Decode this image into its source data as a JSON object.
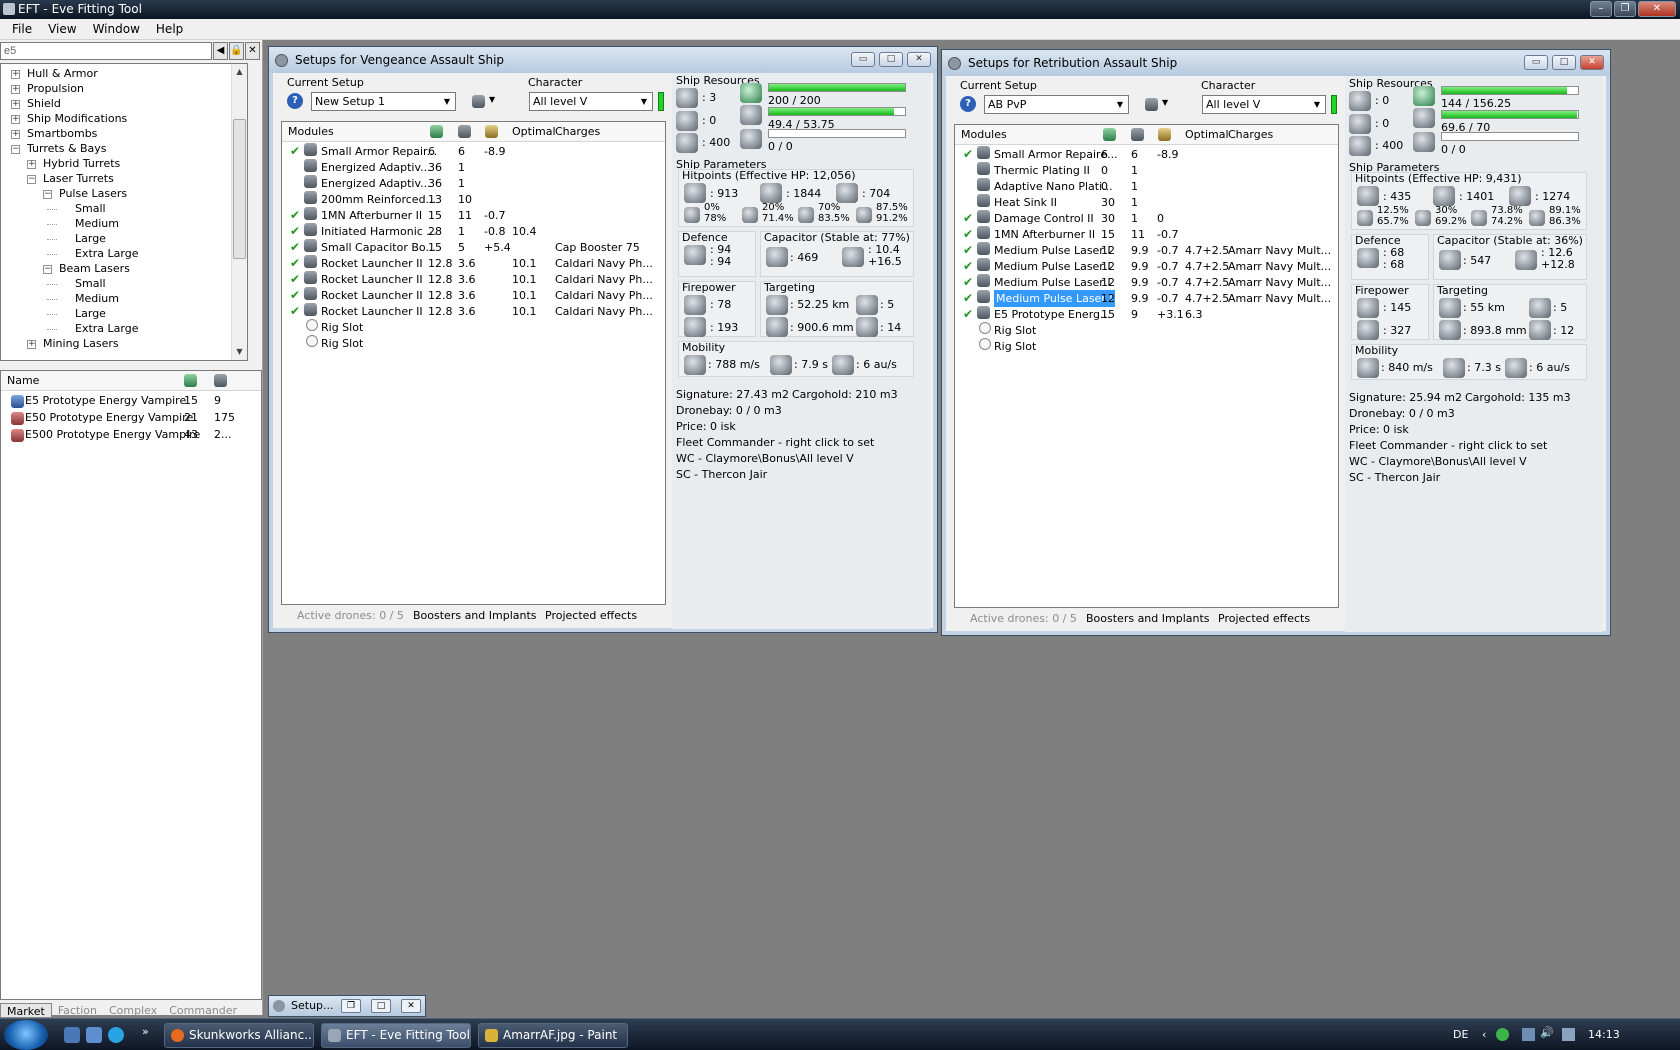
{
  "app": {
    "title": "EFT - Eve Fitting Tool",
    "menu": [
      "File",
      "View",
      "Window",
      "Help"
    ]
  },
  "left": {
    "search_value": "e5",
    "tree": [
      {
        "label": "Hull & Armor",
        "sign": "+"
      },
      {
        "label": "Propulsion",
        "sign": "+"
      },
      {
        "label": "Shield",
        "sign": "+"
      },
      {
        "label": "Ship Modifications",
        "sign": "+"
      },
      {
        "label": "Smartbombs",
        "sign": "+"
      },
      {
        "label": "Turrets & Bays",
        "sign": "−"
      },
      {
        "label": "Hybrid Turrets",
        "sign": "+"
      },
      {
        "label": "Laser Turrets",
        "sign": "−"
      },
      {
        "label": "Pulse Lasers",
        "sign": "−"
      },
      {
        "label": "Small",
        "sign": ""
      },
      {
        "label": "Medium",
        "sign": ""
      },
      {
        "label": "Large",
        "sign": ""
      },
      {
        "label": "Extra Large",
        "sign": ""
      },
      {
        "label": "Beam Lasers",
        "sign": "−"
      },
      {
        "label": "Small",
        "sign": ""
      },
      {
        "label": "Medium",
        "sign": ""
      },
      {
        "label": "Large",
        "sign": ""
      },
      {
        "label": "Extra Large",
        "sign": ""
      },
      {
        "label": "Mining Lasers",
        "sign": "+"
      }
    ],
    "list_header": "Name",
    "items": [
      {
        "name": "E5 Prototype Energy Vampire",
        "c1": "15",
        "c2": "9"
      },
      {
        "name": "E50 Prototype Energy Vampire",
        "c1": "21",
        "c2": "175"
      },
      {
        "name": "E500 Prototype Energy Vampire",
        "c1": "43",
        "c2": "2..."
      }
    ],
    "bottom_tabs": [
      "Market",
      "Faction",
      "Complex",
      "Commander"
    ]
  },
  "win1": {
    "title": "Setups for Vengeance Assault Ship",
    "current_setup_label": "Current Setup",
    "setup": "New Setup 1",
    "character_label": "Character",
    "character": "All level V",
    "cols": {
      "modules": "Modules",
      "optimal": "Optimal",
      "charges": "Charges"
    },
    "modules": [
      {
        "check": "✔",
        "name": "Small Armor Repair...",
        "a": "6",
        "b": "6",
        "c": "-8.9",
        "opt": "",
        "charge": ""
      },
      {
        "check": "",
        "name": "Energized Adaptiv...",
        "a": "36",
        "b": "1",
        "c": "",
        "opt": "",
        "charge": ""
      },
      {
        "check": "",
        "name": "Energized Adaptiv...",
        "a": "36",
        "b": "1",
        "c": "",
        "opt": "",
        "charge": ""
      },
      {
        "check": "",
        "name": "200mm Reinforced...",
        "a": "13",
        "b": "10",
        "c": "",
        "opt": "",
        "charge": ""
      },
      {
        "check": "✔",
        "name": "1MN Afterburner II",
        "a": "15",
        "b": "11",
        "c": "-0.7",
        "opt": "",
        "charge": ""
      },
      {
        "check": "✔",
        "name": "Initiated Harmonic ...",
        "a": "28",
        "b": "1",
        "c": "-0.8",
        "opt": "10.4",
        "charge": ""
      },
      {
        "check": "✔",
        "name": "Small Capacitor Bo...",
        "a": "15",
        "b": "5",
        "c": "+5.4",
        "opt": "",
        "charge": "Cap Booster 75"
      },
      {
        "check": "✔",
        "name": "Rocket Launcher II",
        "a": "12.8",
        "b": "3.6",
        "c": "",
        "opt": "10.1",
        "charge": "Caldari Navy Ph..."
      },
      {
        "check": "✔",
        "name": "Rocket Launcher II",
        "a": "12.8",
        "b": "3.6",
        "c": "",
        "opt": "10.1",
        "charge": "Caldari Navy Ph..."
      },
      {
        "check": "✔",
        "name": "Rocket Launcher II",
        "a": "12.8",
        "b": "3.6",
        "c": "",
        "opt": "10.1",
        "charge": "Caldari Navy Ph..."
      },
      {
        "check": "✔",
        "name": "Rocket Launcher II",
        "a": "12.8",
        "b": "3.6",
        "c": "",
        "opt": "10.1",
        "charge": "Caldari Navy Ph..."
      }
    ],
    "rigs": [
      "Rig Slot",
      "Rig Slot"
    ],
    "bottom": {
      "drones": "Active drones: 0 / 5",
      "boosters": "Boosters and Implants",
      "projected": "Projected effects"
    },
    "res": {
      "label": "Ship Resources",
      "hi": ": 3",
      "turret": ": 0",
      "cal": ": 400",
      "cpu": "200 / 200",
      "cpu_frac": 1.0,
      "pg": "49.4 / 53.75",
      "pg_frac": 0.92,
      "drone": "0 / 0",
      "drone_frac": 0
    },
    "params_label": "Ship Parameters",
    "hp": {
      "label": "Hitpoints (Effective HP: 12,056)",
      "shield": ": 913",
      "armor": ": 1844",
      "hull": ": 704"
    },
    "resist": [
      [
        "0%",
        "78%"
      ],
      [
        "20%",
        "71.4%"
      ],
      [
        "70%",
        "83.5%"
      ],
      [
        "87.5%",
        "91.2%"
      ]
    ],
    "defence": {
      "label": "Defence",
      "v1": ": 94",
      "v2": ": 94"
    },
    "cap": {
      "label": "Capacitor (Stable at: 77%)",
      "v": ": 469",
      "r1": ": 10.4",
      "r2": "+16.5"
    },
    "fire": {
      "label": "Firepower",
      "v1": ": 78",
      "v2": ": 193"
    },
    "target": {
      "label": "Targeting",
      "range": ": 52.25 km",
      "res": ": 900.6 mm",
      "max": ": 5",
      "sens": ": 14"
    },
    "mob": {
      "label": "Mobility",
      "speed": ": 788 m/s",
      "align": ": 7.9 s",
      "warp": ": 6 au/s"
    },
    "info": [
      "Signature: 27.43 m2",
      "Cargohold: 210 m3",
      "Dronebay: 0 / 0 m3",
      "Price: 0 isk",
      "Fleet Commander - right click to set",
      "WC - Claymore\\Bonus\\All level V",
      "SC - Thercon Jair"
    ]
  },
  "win2": {
    "title": "Setups for Retribution Assault Ship",
    "current_setup_label": "Current Setup",
    "setup": "AB PvP",
    "character_label": "Character",
    "character": "All level V",
    "cols": {
      "modules": "Modules",
      "optimal": "Optimal",
      "charges": "Charges"
    },
    "modules": [
      {
        "check": "✔",
        "name": "Small Armor Repaire...",
        "a": "6",
        "b": "6",
        "c": "-8.9",
        "opt": "",
        "charge": ""
      },
      {
        "check": "",
        "name": "Thermic Plating II",
        "a": "0",
        "b": "1",
        "c": "",
        "opt": "",
        "charge": ""
      },
      {
        "check": "",
        "name": "Adaptive Nano Plati...",
        "a": "0",
        "b": "1",
        "c": "",
        "opt": "",
        "charge": ""
      },
      {
        "check": "",
        "name": "Heat Sink II",
        "a": "30",
        "b": "1",
        "c": "",
        "opt": "",
        "charge": ""
      },
      {
        "check": "✔",
        "name": "Damage Control II",
        "a": "30",
        "b": "1",
        "c": "0",
        "opt": "",
        "charge": ""
      },
      {
        "check": "✔",
        "name": "1MN Afterburner II",
        "a": "15",
        "b": "11",
        "c": "-0.7",
        "opt": "",
        "charge": ""
      },
      {
        "check": "✔",
        "name": "Medium Pulse Laser I",
        "a": "12",
        "b": "9.9",
        "c": "-0.7",
        "opt": "4.7+2.5",
        "charge": "Amarr Navy Mult..."
      },
      {
        "check": "✔",
        "name": "Medium Pulse Laser I",
        "a": "12",
        "b": "9.9",
        "c": "-0.7",
        "opt": "4.7+2.5",
        "charge": "Amarr Navy Mult..."
      },
      {
        "check": "✔",
        "name": "Medium Pulse Laser I",
        "a": "12",
        "b": "9.9",
        "c": "-0.7",
        "opt": "4.7+2.5",
        "charge": "Amarr Navy Mult..."
      },
      {
        "check": "✔",
        "name": "Medium Pulse Laser I",
        "a": "12",
        "b": "9.9",
        "c": "-0.7",
        "opt": "4.7+2.5",
        "charge": "Amarr Navy Mult...",
        "selected": true
      },
      {
        "check": "✔",
        "name": "E5 Prototype Energ...",
        "a": "15",
        "b": "9",
        "c": "+3.1",
        "opt": "6.3",
        "charge": ""
      }
    ],
    "rigs": [
      "Rig Slot",
      "Rig Slot"
    ],
    "bottom": {
      "drones": "Active drones: 0 / 5",
      "boosters": "Boosters and Implants",
      "projected": "Projected effects"
    },
    "res": {
      "label": "Ship Resources",
      "hi": ": 0",
      "turret": ": 0",
      "cal": ": 400",
      "cpu": "144 / 156.25",
      "cpu_frac": 0.92,
      "pg": "69.6 / 70",
      "pg_frac": 0.99,
      "drone": "0 / 0",
      "drone_frac": 0
    },
    "params_label": "Ship Parameters",
    "hp": {
      "label": "Hitpoints (Effective HP: 9,431)",
      "shield": ": 435",
      "armor": ": 1401",
      "hull": ": 1274"
    },
    "resist": [
      [
        "12.5%",
        "65.7%"
      ],
      [
        "30%",
        "69.2%"
      ],
      [
        "73.8%",
        "74.2%"
      ],
      [
        "89.1%",
        "86.3%"
      ]
    ],
    "defence": {
      "label": "Defence",
      "v1": ": 68",
      "v2": ": 68"
    },
    "cap": {
      "label": "Capacitor (Stable at: 36%)",
      "v": ": 547",
      "r1": ": 12.6",
      "r2": "+12.8"
    },
    "fire": {
      "label": "Firepower",
      "v1": ": 145",
      "v2": ": 327"
    },
    "target": {
      "label": "Targeting",
      "range": ": 55 km",
      "res": ": 893.8 mm",
      "max": ": 5",
      "sens": ": 12"
    },
    "mob": {
      "label": "Mobility",
      "speed": ": 840 m/s",
      "align": ": 7.3 s",
      "warp": ": 6 au/s"
    },
    "info": [
      "Signature: 25.94 m2",
      "Cargohold: 135 m3",
      "Dronebay: 0 / 0 m3",
      "Price: 0 isk",
      "Fleet Commander - right click to set",
      "WC - Claymore\\Bonus\\All level V",
      "SC - Thercon Jair"
    ]
  },
  "mini": {
    "label": "Setup..."
  },
  "taskbar": {
    "tasks": [
      "Skunkworks Allianc...",
      "EFT - Eve Fitting Tool",
      "AmarrAF.jpg - Paint"
    ],
    "lang": "DE",
    "time": "14:13"
  }
}
